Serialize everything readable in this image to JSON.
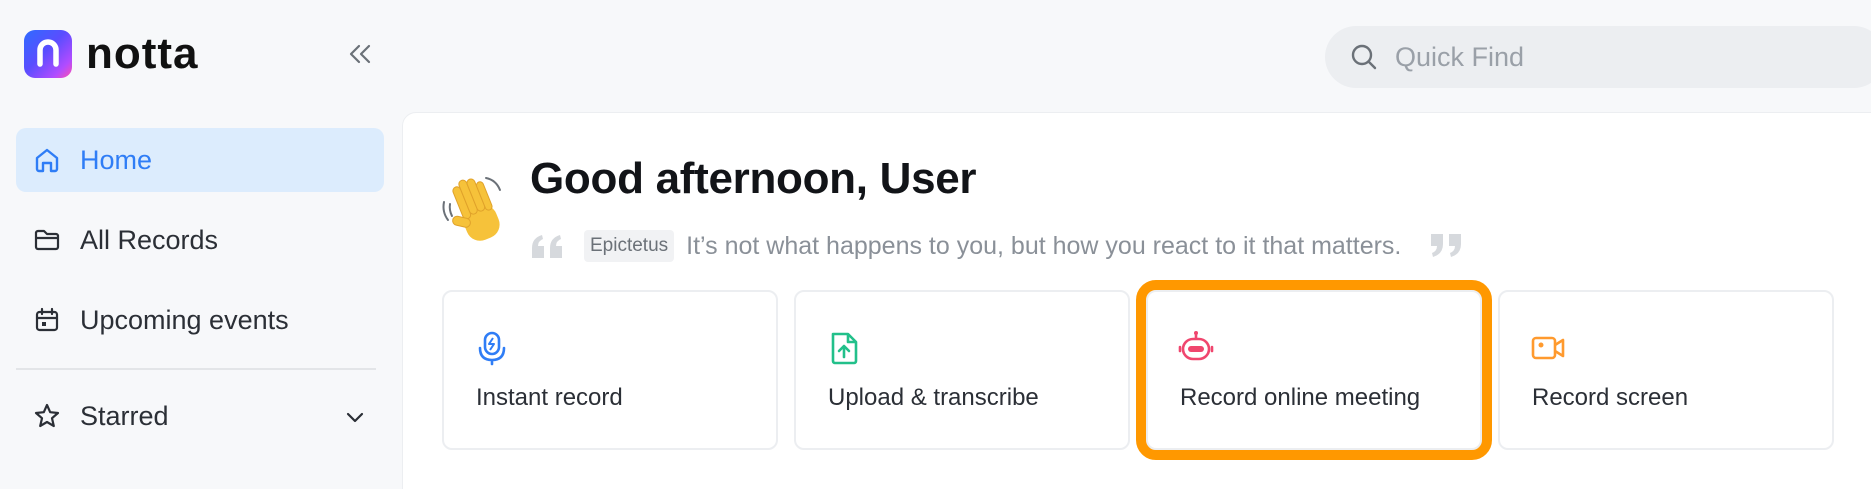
{
  "app": {
    "name": "notta",
    "logo_letter": "n"
  },
  "sidebar": {
    "items": [
      {
        "label": "Home",
        "icon": "home-icon",
        "active": true
      },
      {
        "label": "All Records",
        "icon": "folder-icon",
        "active": false
      },
      {
        "label": "Upcoming events",
        "icon": "calendar-icon",
        "active": false
      }
    ],
    "starred": {
      "label": "Starred",
      "icon": "star-icon"
    }
  },
  "search": {
    "placeholder": "Quick Find"
  },
  "main": {
    "greeting": "Good afternoon, User",
    "quote": {
      "author": "Epictetus",
      "text": "It’s not what happens to you, but how you react to it that matters."
    },
    "cards": [
      {
        "label": "Instant record",
        "icon": "microphone-icon",
        "color": "#2f7df6"
      },
      {
        "label": "Upload & transcribe",
        "icon": "file-upload-icon",
        "color": "#22c08a"
      },
      {
        "label": "Record online meeting",
        "icon": "robot-icon",
        "color": "#f0466e",
        "highlighted": true
      },
      {
        "label": "Record screen",
        "icon": "video-camera-icon",
        "color": "#ff9a2e"
      }
    ]
  },
  "colors": {
    "accent": "#2f7df6",
    "highlight": "#ff9800",
    "active_nav_bg": "#dcecfd"
  }
}
